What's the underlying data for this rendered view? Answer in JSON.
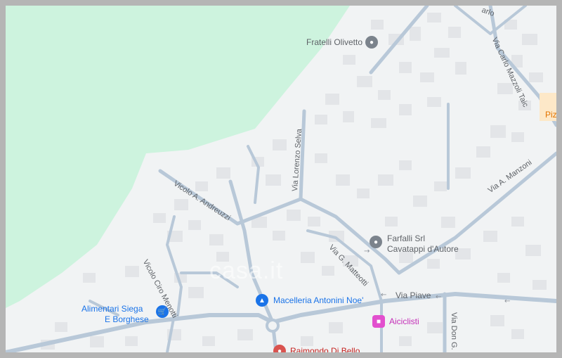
{
  "colors": {
    "land": "#f1f3f4",
    "park": "#cdf3de",
    "road": "#b8c8d8",
    "building": "#e3e5e8",
    "grey_poi": "#7b838c",
    "blue_poi": "#1a73e8",
    "pink_poi": "#e24fce",
    "red_poi": "#d9534f",
    "text_grey": "#5f6368",
    "text_blue": "#1a73e8",
    "text_pink": "#c430b8",
    "text_red": "#c5221f",
    "text_orange": "#e37400"
  },
  "pois": {
    "fratelli_olivetto": "Fratelli Olivetto",
    "farfalli_line1": "Farfalli Srl",
    "farfalli_line2": "Cavatappi d'Autore",
    "alimentari_line1": "Alimentari Siega",
    "alimentari_line2": "E Borghese",
    "macelleria": "Macelleria Antonini Noe'",
    "aiciclisti": "Aiciclisti",
    "raimondo": "Raimondo Di Bello",
    "piz": "Piz"
  },
  "streets": {
    "vicolo_andreuzzi": "Vicolo A. Andreuzzi",
    "via_lorenzo_selva": "Via Lorenzo Selva",
    "via_carlo_mazzoli": "Via Carlo Mazzoli Taic",
    "via_manzoni": "Via A. Manzoni",
    "via_mattiotti": "Via G. Matteotti",
    "vicolo_menotti": "Vicolo Ciro Menotti",
    "via_piave": "Via Piave",
    "via_don": "Via Don G.",
    "arlo": "arlo"
  },
  "watermark": "casa.it"
}
